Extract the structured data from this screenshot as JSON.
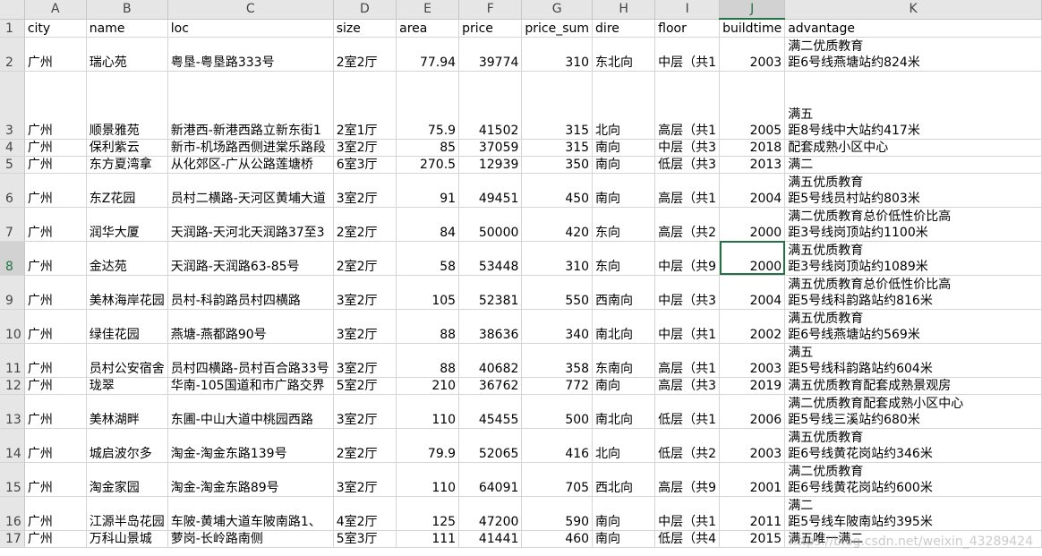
{
  "sheet": {
    "columns": [
      "A",
      "B",
      "C",
      "D",
      "E",
      "F",
      "G",
      "H",
      "I",
      "J",
      "K"
    ],
    "active_cell": "J8",
    "rows": [
      {
        "n": "1",
        "city": "city",
        "name": "name",
        "loc": "loc",
        "size": "size",
        "area": "area",
        "price": "price",
        "price_sum": "price_sum",
        "dire": "dire",
        "floor": "floor",
        "buildtime": "buildtime",
        "advantage": "advantage"
      },
      {
        "n": "2",
        "city": "广州",
        "name": "瑞心苑",
        "loc": "粤垦-粤垦路333号",
        "size": "2室2厅",
        "area": "77.94",
        "price": "39774",
        "price_sum": "310",
        "dire": "东北向",
        "floor": "中层（共1",
        "buildtime": "2003",
        "advantage": "满二优质教育\n距6号线燕塘站约824米"
      },
      {
        "n": "3",
        "city": "广州",
        "name": "顺景雅苑",
        "loc": "新港西-新港西路立新东街1",
        "size": "2室1厅",
        "area": "75.9",
        "price": "41502",
        "price_sum": "315",
        "dire": "北向",
        "floor": "高层（共1",
        "buildtime": "2005",
        "advantage": "满五\n距8号线中大站约417米"
      },
      {
        "n": "4",
        "city": "广州",
        "name": "保利紫云",
        "loc": "新市-机场路西侧进棠乐路段",
        "size": "3室2厅",
        "area": "85",
        "price": "37059",
        "price_sum": "315",
        "dire": "南向",
        "floor": "中层（共3",
        "buildtime": "2018",
        "advantage": "配套成熟小区中心"
      },
      {
        "n": "5",
        "city": "广州",
        "name": "东方夏湾拿",
        "loc": "从化郊区-广从公路莲塘桥",
        "size": "6室3厅",
        "area": "270.5",
        "price": "12939",
        "price_sum": "350",
        "dire": "南向",
        "floor": "低层（共3",
        "buildtime": "2013",
        "advantage": "满二"
      },
      {
        "n": "6",
        "city": "广州",
        "name": "东Z花园",
        "loc": "员村二横路-天河区黄埔大道",
        "size": "3室2厅",
        "area": "91",
        "price": "49451",
        "price_sum": "450",
        "dire": "南向",
        "floor": "高层（共1",
        "buildtime": "2004",
        "advantage": "满五优质教育\n距5号线员村站约803米"
      },
      {
        "n": "7",
        "city": "广州",
        "name": "润华大厦",
        "loc": "天润路-天河北天润路37至3",
        "size": "2室2厅",
        "area": "84",
        "price": "50000",
        "price_sum": "420",
        "dire": "东向",
        "floor": "高层（共2",
        "buildtime": "2000",
        "advantage": "满二优质教育总价低性价比高\n距3号线岗顶站约1100米"
      },
      {
        "n": "8",
        "city": "广州",
        "name": "金达苑",
        "loc": "天润路-天润路63-85号",
        "size": "2室2厅",
        "area": "58",
        "price": "53448",
        "price_sum": "310",
        "dire": "东向",
        "floor": "中层（共9",
        "buildtime": "2000",
        "advantage": "满五优质教育\n距3号线岗顶站约1089米"
      },
      {
        "n": "9",
        "city": "广州",
        "name": "美林海岸花园",
        "loc": "员村-科韵路员村四横路",
        "size": "3室2厅",
        "area": "105",
        "price": "52381",
        "price_sum": "550",
        "dire": "西南向",
        "floor": "中层（共3",
        "buildtime": "2004",
        "advantage": "满五优质教育总价低性价比高\n距5号线科韵路站约816米"
      },
      {
        "n": "10",
        "city": "广州",
        "name": "绿佳花园",
        "loc": "燕塘-燕都路90号",
        "size": "3室2厅",
        "area": "88",
        "price": "38636",
        "price_sum": "340",
        "dire": "南北向",
        "floor": "中层（共1",
        "buildtime": "2002",
        "advantage": "满五优质教育\n距6号线燕塘站约569米"
      },
      {
        "n": "11",
        "city": "广州",
        "name": "员村公安宿舍",
        "loc": "员村四横路-员村百合路33号",
        "size": "3室2厅",
        "area": "88",
        "price": "40682",
        "price_sum": "358",
        "dire": "东南向",
        "floor": "高层（共1",
        "buildtime": "2003",
        "advantage": "满五\n距5号线科韵路站约604米"
      },
      {
        "n": "12",
        "city": "广州",
        "name": "珑翠",
        "loc": "华南-105国道和市广路交界",
        "size": "5室2厅",
        "area": "210",
        "price": "36762",
        "price_sum": "772",
        "dire": "南向",
        "floor": "高层（共3",
        "buildtime": "2019",
        "advantage": "满五优质教育配套成熟景观房"
      },
      {
        "n": "13",
        "city": "广州",
        "name": "美林湖畔",
        "loc": "东圃-中山大道中桃园西路",
        "size": "3室2厅",
        "area": "110",
        "price": "45455",
        "price_sum": "500",
        "dire": "南北向",
        "floor": "低层（共1",
        "buildtime": "2006",
        "advantage": "满二优质教育配套成熟小区中心\n距5号线三溪站约680米"
      },
      {
        "n": "14",
        "city": "广州",
        "name": "城启波尔多",
        "loc": "淘金-淘金东路139号",
        "size": "2室2厅",
        "area": "79.9",
        "price": "52065",
        "price_sum": "416",
        "dire": "北向",
        "floor": "低层（共2",
        "buildtime": "2003",
        "advantage": "满五优质教育\n距6号线黄花岗站约346米"
      },
      {
        "n": "15",
        "city": "广州",
        "name": "淘金家园",
        "loc": "淘金-淘金东路89号",
        "size": "3室2厅",
        "area": "110",
        "price": "64091",
        "price_sum": "705",
        "dire": "西北向",
        "floor": "高层（共9",
        "buildtime": "2001",
        "advantage": "满二优质教育\n距6号线黄花岗站约600米"
      },
      {
        "n": "16",
        "city": "广州",
        "name": "江源半岛花园",
        "loc": "车陂-黄埔大道车陂南路1、",
        "size": "4室2厅",
        "area": "125",
        "price": "47200",
        "price_sum": "590",
        "dire": "南向",
        "floor": "中层（共1",
        "buildtime": "2011",
        "advantage": "满二\n距5号线车陂南站约395米"
      },
      {
        "n": "17",
        "city": "广州",
        "name": "万科山景城",
        "loc": "萝岗-长岭路南侧",
        "size": "5室3厅",
        "area": "111",
        "price": "41441",
        "price_sum": "460",
        "dire": "南向",
        "floor": "低层（共4",
        "buildtime": "2015",
        "advantage": "满五唯一满二"
      }
    ]
  },
  "watermark": "https://blog.csdn.net/weixin_43289424"
}
